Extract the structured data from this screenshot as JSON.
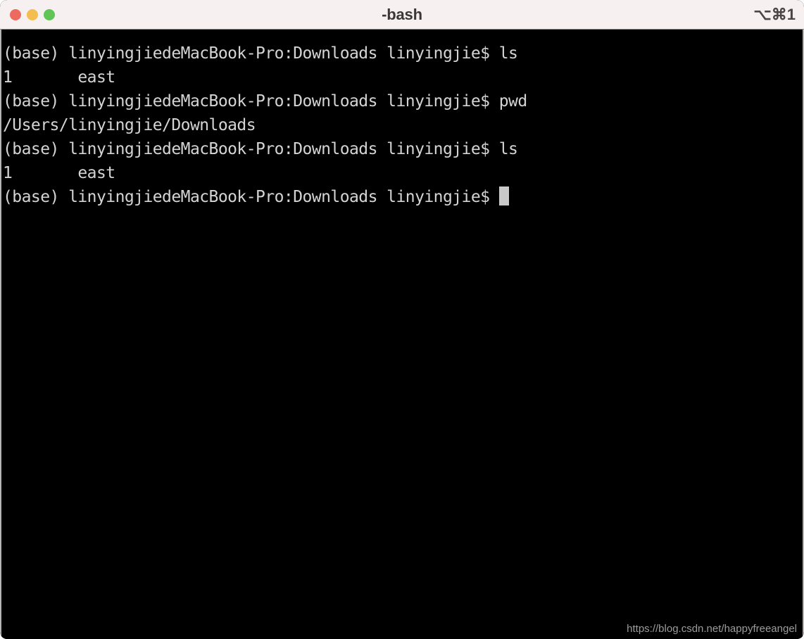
{
  "window": {
    "title": "-bash",
    "shortcut": "⌥⌘1",
    "controls": [
      {
        "name": "close",
        "label": "Close",
        "color": "#ED6A5E"
      },
      {
        "name": "minimize",
        "label": "Minimize",
        "color": "#F4BD4F"
      },
      {
        "name": "zoom",
        "label": "Zoom",
        "color": "#61C555"
      }
    ]
  },
  "terminal": {
    "background": "#000000",
    "foreground": "#d4d4d4",
    "cursor_color": "#c9c9c9",
    "prompt": "(base) linyingjiedeMacBook-Pro:Downloads linyingjie$ ",
    "lines": [
      "(base) linyingjiedeMacBook-Pro:Downloads linyingjie$ ls",
      "1       east",
      "(base) linyingjiedeMacBook-Pro:Downloads linyingjie$ pwd",
      "/Users/linyingjie/Downloads",
      "(base) linyingjiedeMacBook-Pro:Downloads linyingjie$ ls",
      "1       east",
      "(base) linyingjiedeMacBook-Pro:Downloads linyingjie$ "
    ],
    "cursor_line_index": 6
  },
  "watermark": {
    "text": "https://blog.csdn.net/happyfreeangel"
  }
}
